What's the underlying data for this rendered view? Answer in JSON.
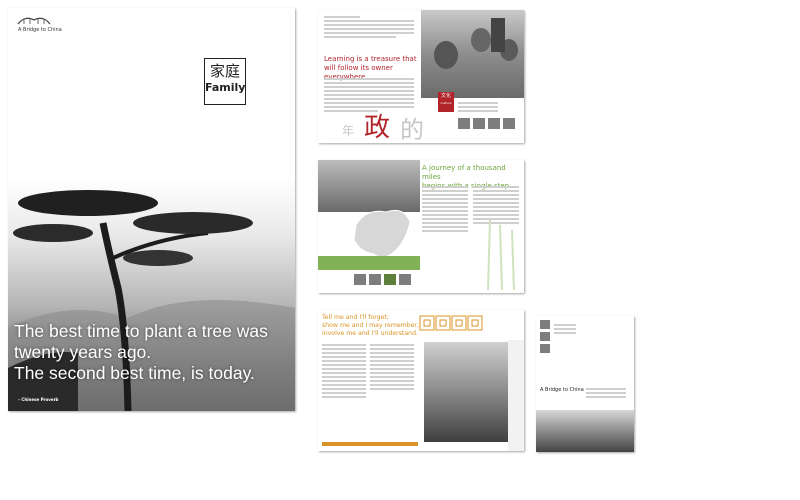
{
  "cover": {
    "logo_text": "A Bridge to China",
    "badge_chinese": "家庭",
    "badge_english": "Family",
    "quote_line1": "The best time to plant a tree was",
    "quote_line2": "twenty years ago.",
    "quote_line3": "The second best time, is today.",
    "attribution": "– Chinese Proverb"
  },
  "spread1": {
    "heading": "Learning is a treasure that will follow its owner everywhere.",
    "tag_chinese": "文化",
    "tag_english": "Culture",
    "big_glyphs": [
      "年",
      "政",
      "的"
    ]
  },
  "spread2": {
    "heading_line1": "A journey of a thousand miles",
    "heading_line2": "begins with a single step"
  },
  "spread3": {
    "heading_line1": "Tell me and I'll forget;",
    "heading_line2": "show me and I may remember;",
    "heading_line3": "involve me and I'll understand."
  },
  "postcard": {
    "title": "A Bridge to China"
  },
  "colors": {
    "culture_red": "#b0242a",
    "journey_green": "#6ba53a",
    "proverb_orange": "#d99425"
  }
}
